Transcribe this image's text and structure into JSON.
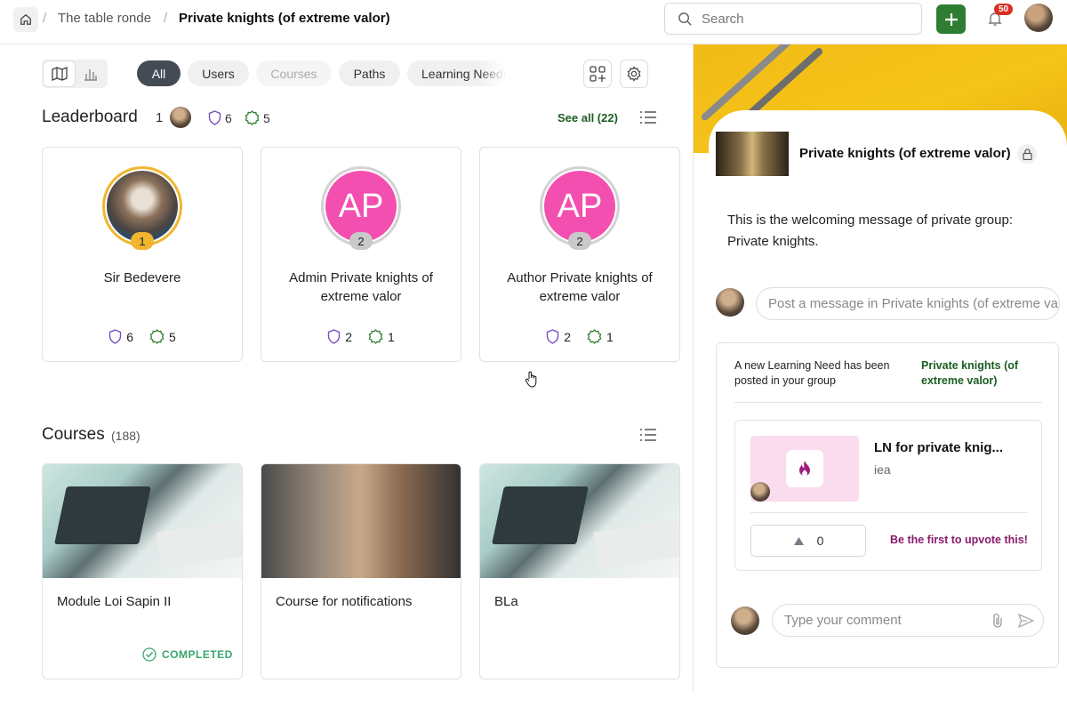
{
  "breadcrumb": {
    "separator": "/",
    "items": [
      "The table ronde",
      "Private knights (of extreme valor)"
    ]
  },
  "search": {
    "placeholder": "Search"
  },
  "notifications": {
    "count": "50"
  },
  "filters": {
    "chips": [
      {
        "label": "All",
        "state": "active"
      },
      {
        "label": "Users",
        "state": "normal"
      },
      {
        "label": "Courses",
        "state": "disabled"
      },
      {
        "label": "Paths",
        "state": "normal"
      },
      {
        "label": "Learning Needs",
        "state": "normal"
      }
    ]
  },
  "leaderboard": {
    "title": "Leaderboard",
    "rank": "1",
    "badges": "6",
    "achievements": "5",
    "see_all": "See all (22)",
    "cards": [
      {
        "name": "Sir Bedevere",
        "rank": "1",
        "initials": "",
        "badges": "6",
        "achievements": "5",
        "avatar": "photo"
      },
      {
        "name": "Admin Private knights of extreme valor",
        "rank": "2",
        "initials": "AP",
        "badges": "2",
        "achievements": "1",
        "avatar": "pink"
      },
      {
        "name": "Author Private knights of extreme valor",
        "rank": "2",
        "initials": "AP",
        "badges": "2",
        "achievements": "1",
        "avatar": "pink"
      }
    ]
  },
  "courses": {
    "title": "Courses",
    "count": "(188)",
    "items": [
      {
        "title": "Module Loi Sapin II",
        "status": "COMPLETED"
      },
      {
        "title": "Course for notifications",
        "status": ""
      },
      {
        "title": "BLa",
        "status": ""
      }
    ]
  },
  "group": {
    "name": "Private knights (of extreme valor)",
    "welcome": "This is the welcoming message of private group: Private knights.",
    "post_placeholder": "Post a message in Private knights (of extreme valor)"
  },
  "feed": {
    "text": "A new Learning Need has been posted in your group",
    "group_link": "Private knights (of extreme valor)",
    "learning_need": {
      "title": "LN for private knig...",
      "subtitle": "iea"
    },
    "upvotes": "0",
    "upvote_prompt": "Be the first to upvote this!",
    "comment_placeholder": "Type your comment"
  },
  "colors": {
    "accent_green": "#2f7d32",
    "link_green": "#1b5e20",
    "badge_red": "#d93025",
    "avatar_pink": "#f34fb0",
    "rank_gold": "#f0b62d",
    "banner_yellow": "#f2bb17",
    "upvote_purple": "#8a1c6d",
    "completed_green": "#3aa76d"
  },
  "icons": [
    "home-icon",
    "search-icon",
    "plus-icon",
    "bell-icon",
    "map-icon",
    "bar-chart-icon",
    "apps-add-icon",
    "settings-icon",
    "shield-icon",
    "star-badge-icon",
    "list-icon",
    "lock-icon",
    "check-circle-icon",
    "flame-icon",
    "triangle-up-icon",
    "paperclip-icon",
    "send-icon"
  ]
}
